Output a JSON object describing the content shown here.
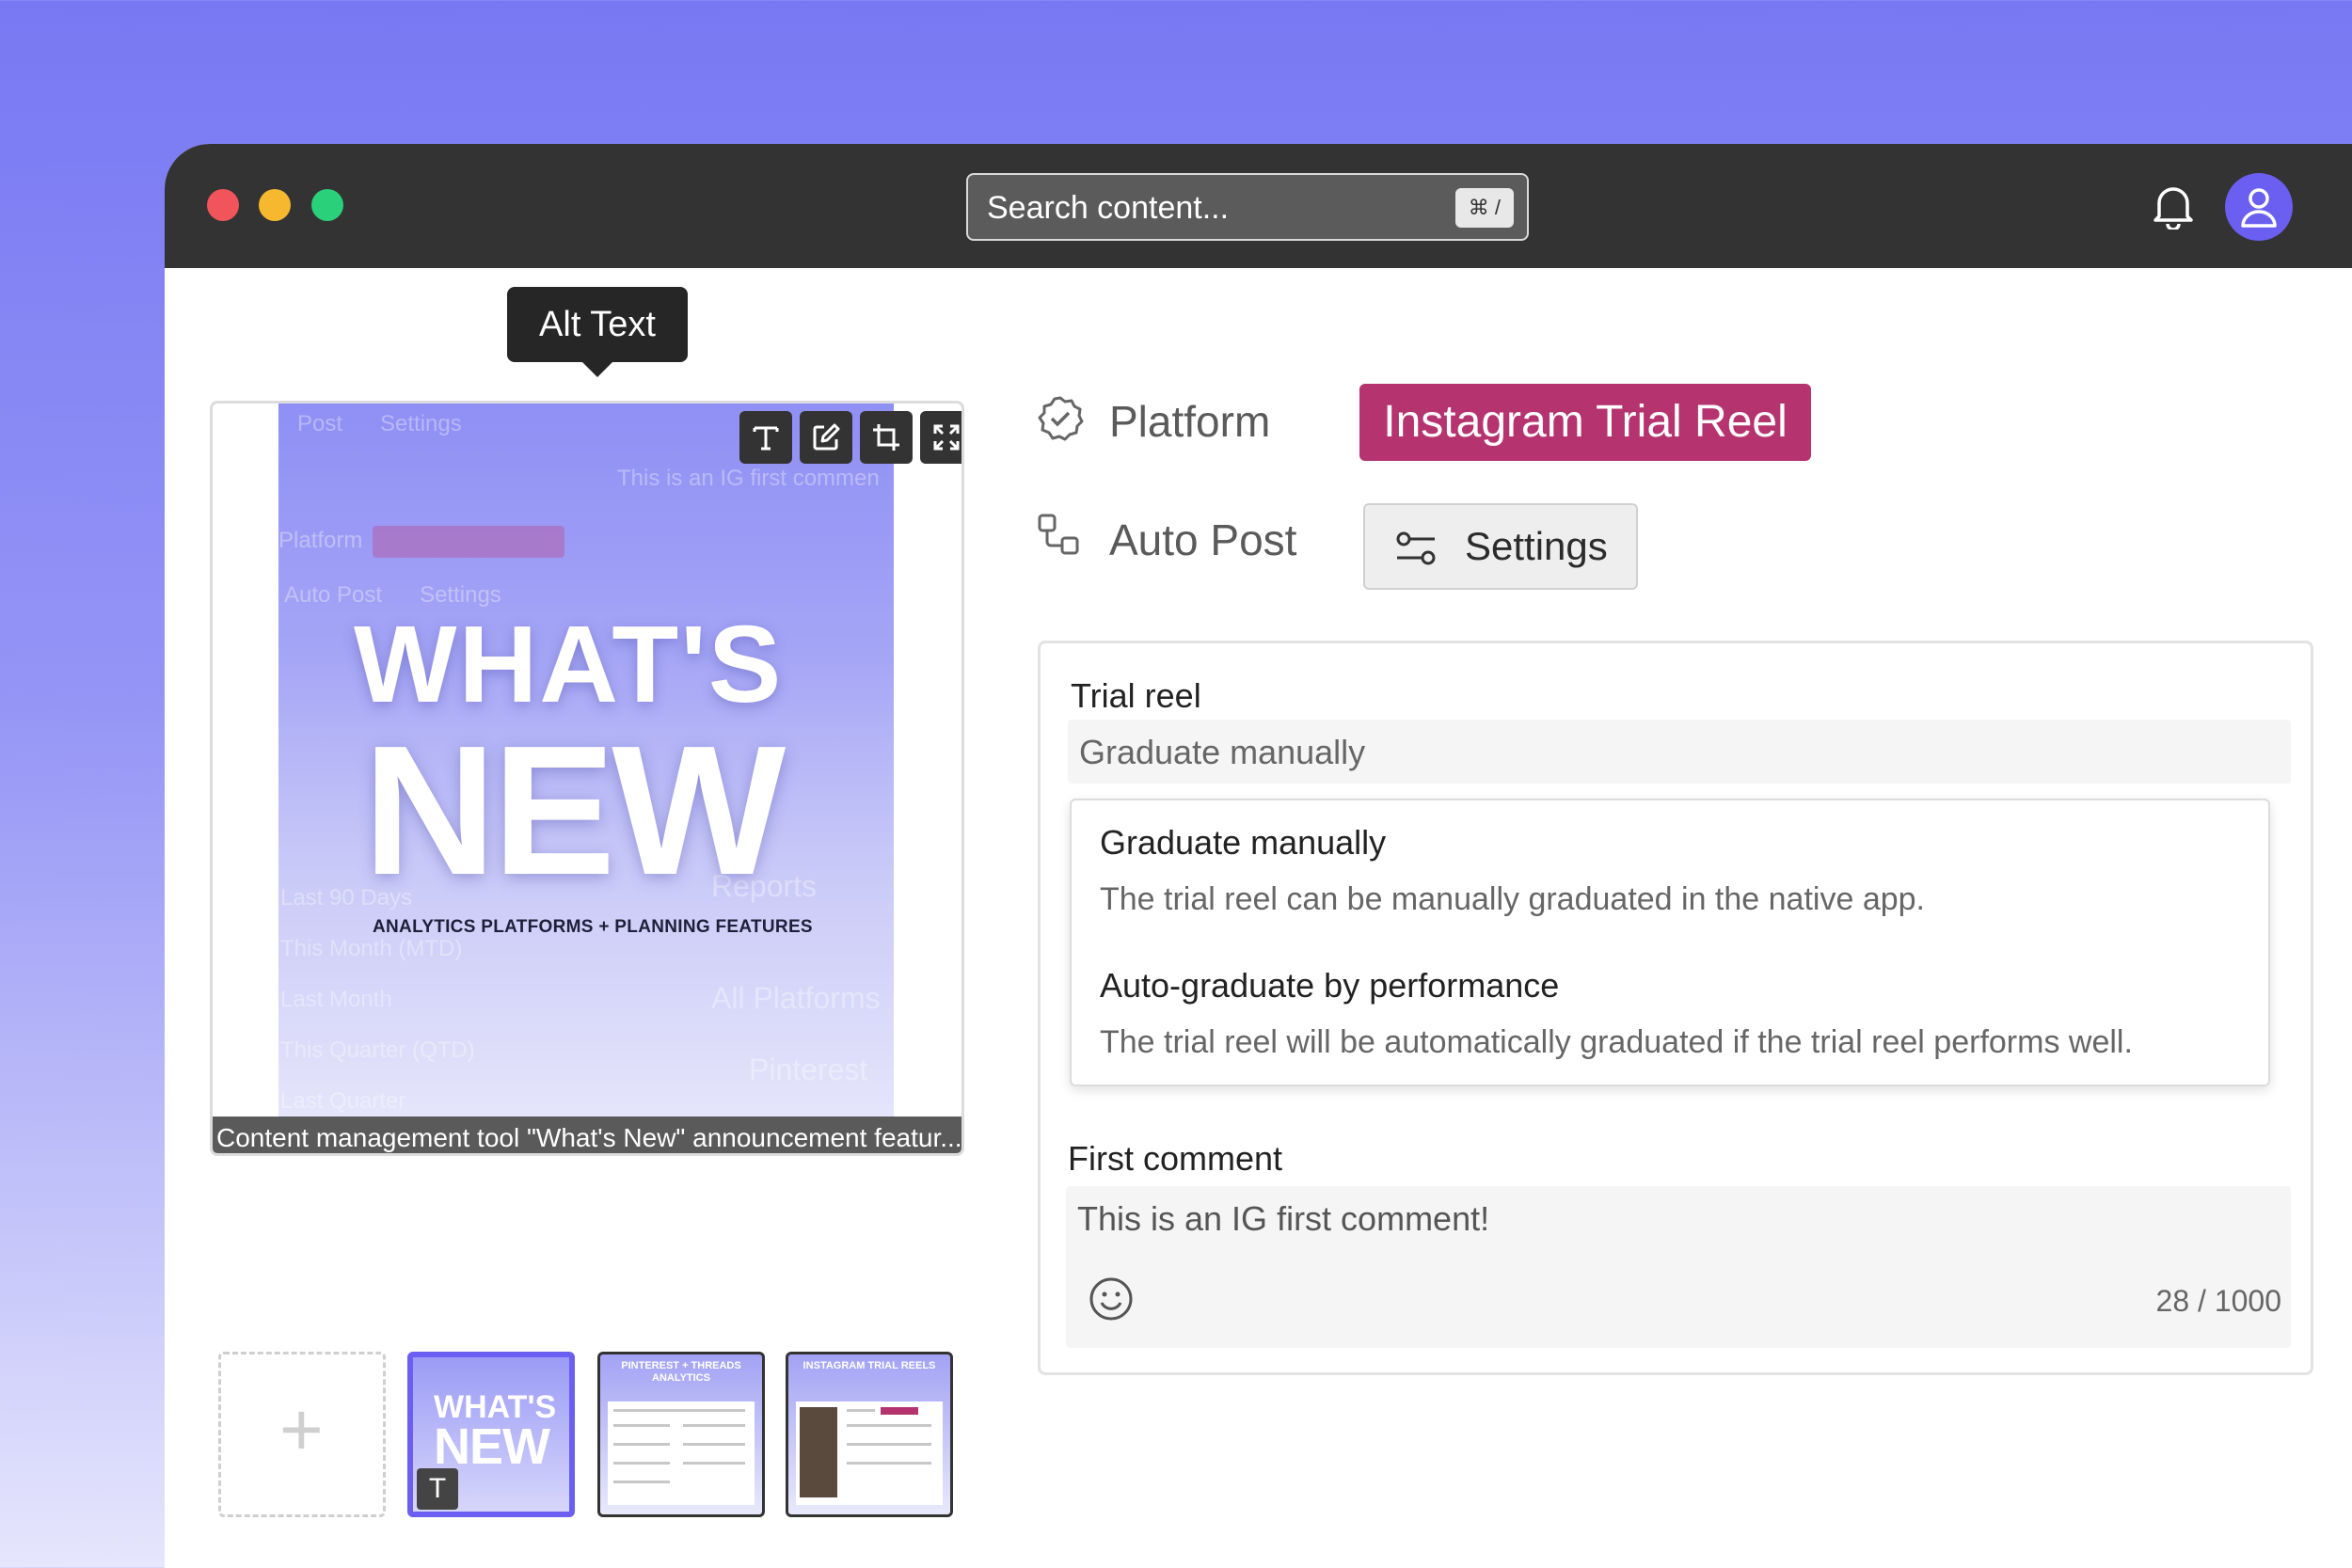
{
  "search": {
    "placeholder": "Search content...",
    "shortcut": "⌘ /"
  },
  "tooltip": {
    "label": "Alt Text"
  },
  "media": {
    "headline_line1": "WHAT'S",
    "headline_line2": "NEW",
    "subline": "ANALYTICS PLATFORMS + PLANNING FEATURES",
    "caption": "Content management tool \"What's New\" announcement featur...",
    "thumbnails": [
      {
        "label": "",
        "title1": "WHAT'S",
        "title2": "NEW"
      },
      {
        "label": "PINTEREST + THREADS ANALYTICS"
      },
      {
        "label": "INSTAGRAM TRIAL REELS"
      }
    ]
  },
  "platform": {
    "label": "Platform",
    "value": "Instagram Trial Reel"
  },
  "auto_post": {
    "label": "Auto Post",
    "settings_label": "Settings"
  },
  "trial_reel": {
    "label": "Trial reel",
    "selected": "Graduate manually",
    "options": [
      {
        "title": "Graduate manually",
        "description": "The trial reel can be manually graduated in the native app."
      },
      {
        "title": "Auto-graduate by performance",
        "description": "The trial reel will be automatically graduated if the trial reel performs well."
      }
    ]
  },
  "first_comment": {
    "label": "First comment",
    "value": "This is an IG first comment!",
    "counter": "28 / 1000"
  },
  "colors": {
    "accent": "#6a5ff0",
    "platform_badge": "#b5336e",
    "delete": "#f05a5a"
  }
}
